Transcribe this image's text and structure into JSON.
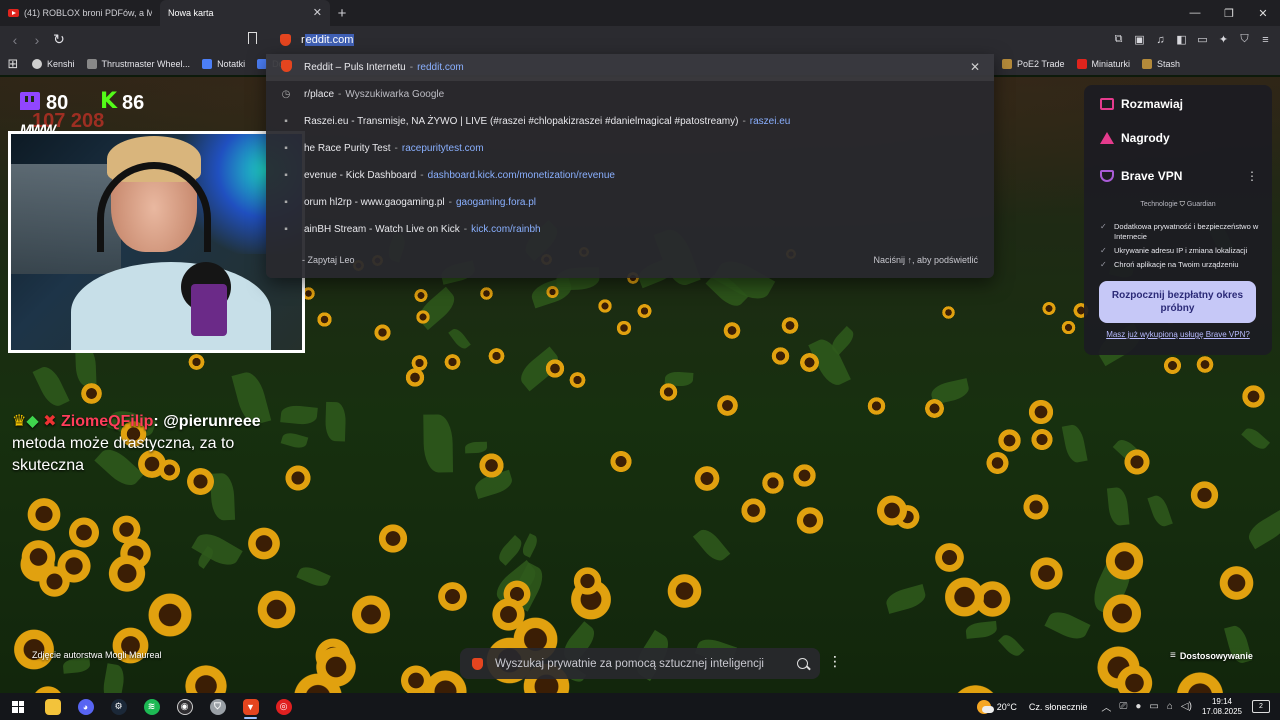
{
  "browser": {
    "tabs": [
      {
        "label": "(41) ROBLOX broni PDFów, a Master"
      },
      {
        "label": "Nowa karta"
      }
    ],
    "new_tab_symbol": "+",
    "window_controls": [
      "—",
      "❐",
      "✕"
    ]
  },
  "toolbar": {
    "url_value": "reddit.com",
    "url_prefix": "r",
    "url_selected": "eddit.com"
  },
  "bookmarks": {
    "left": [
      "Kenshi",
      "Thrustmaster Wheel...",
      "Notatki",
      "Do"
    ],
    "right": [
      "PoE2 Trade",
      "Miniaturki",
      "Stash"
    ]
  },
  "omnibox": {
    "suggestions": [
      {
        "title": "Reddit – Puls Internetu",
        "url": "reddit.com",
        "icon": "brave-icon"
      },
      {
        "title": "r/place",
        "url": "Wyszukiwarka Google",
        "icon": "history-icon",
        "url_plain": true
      },
      {
        "title": "Raszei.eu - Transmisje, NA ŻYWO | LIVE (#raszei #chlopakizraszei #danielmagical #patostreamy)",
        "url": "raszei.eu",
        "icon": "site-icon"
      },
      {
        "title": "he Race Purity Test",
        "url": "racepuritytest.com",
        "icon": "site-icon"
      },
      {
        "title": "evenue - Kick Dashboard",
        "url": "dashboard.kick.com/monetization/revenue",
        "icon": "site-icon"
      },
      {
        "title": "orum hl2rp - www.gaogaming.pl",
        "url": "gaogaming.fora.pl",
        "icon": "site-icon"
      },
      {
        "title": "ainBH Stream - Watch Live on Kick",
        "url": "kick.com/rainbh",
        "icon": "site-icon"
      }
    ],
    "leo_label": "- Zapytaj Leo",
    "hint": "Naciśnij ↑, aby podświetlić",
    "close_symbol": "✕"
  },
  "overlay": {
    "stat_a": "80",
    "stat_b": "86",
    "sub_stat": "107 208",
    "streamer_tag": "MWW",
    "chat": {
      "user": "ZiomeQFilip",
      "mention": "@pierunreee",
      "message": "metoda może drastyczna, za to skuteczna"
    }
  },
  "vpn_panel": {
    "items": [
      "Rozmawiaj",
      "Nagrody",
      "Brave VPN"
    ],
    "tech_label": "Technologie",
    "tech_brand": "Guardian",
    "features": [
      "Dodatkowa prywatność i bezpieczeństwo w Internecie",
      "Ukrywanie adresu IP i zmiana lokalizacji",
      "Chroń aplikacje na Twoim urządzeniu"
    ],
    "cta": "Rozpocznij bezpłatny okres próbny",
    "link": "Masz już wykupioną usługę Brave VPN?",
    "more_symbol": "⋮"
  },
  "newtab": {
    "photo_credit": "Zdjęcie autorstwa Mogli Maureal",
    "search_placeholder": "Wyszukaj prywatnie za pomocą sztucznej inteligencji",
    "customize": "Dostosowywanie",
    "menu_symbol": "⋮"
  },
  "taskbar": {
    "weather": "20°C",
    "weather_desc": "Cz. słonecznie",
    "time": "19:14",
    "date": "17.08.2025",
    "notifications": "2"
  },
  "colors": {
    "accent": "#9146ff",
    "kick": "#53fc18",
    "brave": "#e4451f",
    "link": "#8ab0ff"
  }
}
